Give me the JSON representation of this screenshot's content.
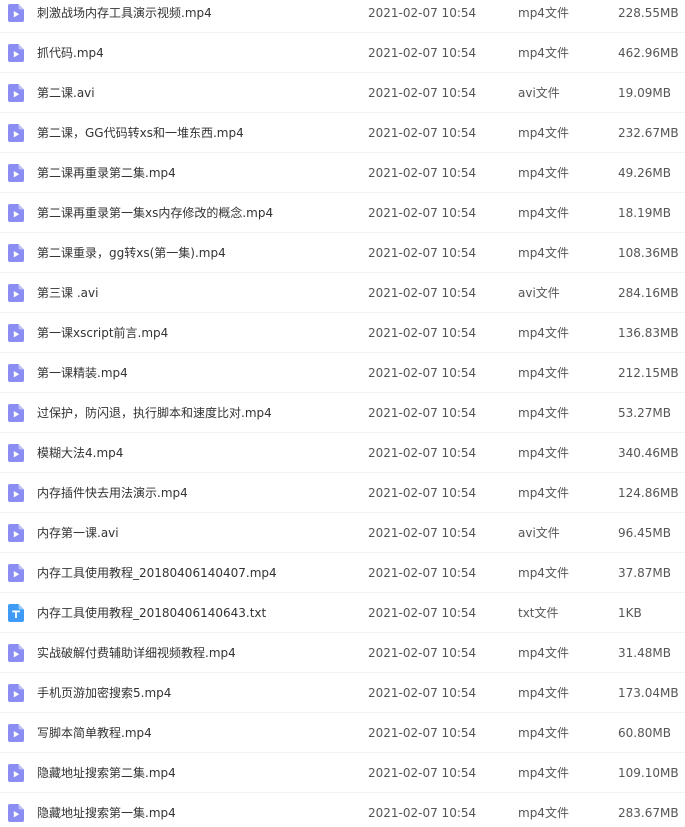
{
  "colors": {
    "video_icon": "#8c8df2",
    "text_icon": "#3f9bf5",
    "row_divider": "#f1f2f4"
  },
  "files": [
    {
      "name": "刺激战场内存工具演示视频.mp4",
      "date": "2021-02-07 10:54",
      "type": "mp4文件",
      "size": "228.55MB",
      "icon": "video-file-icon"
    },
    {
      "name": "抓代码.mp4",
      "date": "2021-02-07 10:54",
      "type": "mp4文件",
      "size": "462.96MB",
      "icon": "video-file-icon"
    },
    {
      "name": "第二课.avi",
      "date": "2021-02-07 10:54",
      "type": "avi文件",
      "size": "19.09MB",
      "icon": "video-file-icon"
    },
    {
      "name": "第二课，GG代码转xs和一堆东西.mp4",
      "date": "2021-02-07 10:54",
      "type": "mp4文件",
      "size": "232.67MB",
      "icon": "video-file-icon"
    },
    {
      "name": "第二课再重录第二集.mp4",
      "date": "2021-02-07 10:54",
      "type": "mp4文件",
      "size": "49.26MB",
      "icon": "video-file-icon"
    },
    {
      "name": "第二课再重录第一集xs内存修改的概念.mp4",
      "date": "2021-02-07 10:54",
      "type": "mp4文件",
      "size": "18.19MB",
      "icon": "video-file-icon"
    },
    {
      "name": "第二课重录，gg转xs(第一集).mp4",
      "date": "2021-02-07 10:54",
      "type": "mp4文件",
      "size": "108.36MB",
      "icon": "video-file-icon"
    },
    {
      "name": "第三课 .avi",
      "date": "2021-02-07 10:54",
      "type": "avi文件",
      "size": "284.16MB",
      "icon": "video-file-icon"
    },
    {
      "name": "第一课xscript前言.mp4",
      "date": "2021-02-07 10:54",
      "type": "mp4文件",
      "size": "136.83MB",
      "icon": "video-file-icon"
    },
    {
      "name": "第一课精装.mp4",
      "date": "2021-02-07 10:54",
      "type": "mp4文件",
      "size": "212.15MB",
      "icon": "video-file-icon"
    },
    {
      "name": "过保护，防闪退，执行脚本和速度比对.mp4",
      "date": "2021-02-07 10:54",
      "type": "mp4文件",
      "size": "53.27MB",
      "icon": "video-file-icon"
    },
    {
      "name": "模糊大法4.mp4",
      "date": "2021-02-07 10:54",
      "type": "mp4文件",
      "size": "340.46MB",
      "icon": "video-file-icon"
    },
    {
      "name": "内存插件快去用法演示.mp4",
      "date": "2021-02-07 10:54",
      "type": "mp4文件",
      "size": "124.86MB",
      "icon": "video-file-icon"
    },
    {
      "name": "内存第一课.avi",
      "date": "2021-02-07 10:54",
      "type": "avi文件",
      "size": "96.45MB",
      "icon": "video-file-icon"
    },
    {
      "name": "内存工具使用教程_20180406140407.mp4",
      "date": "2021-02-07 10:54",
      "type": "mp4文件",
      "size": "37.87MB",
      "icon": "video-file-icon"
    },
    {
      "name": "内存工具使用教程_20180406140643.txt",
      "date": "2021-02-07 10:54",
      "type": "txt文件",
      "size": "1KB",
      "icon": "text-file-icon"
    },
    {
      "name": "实战破解付费辅助详细视频教程.mp4",
      "date": "2021-02-07 10:54",
      "type": "mp4文件",
      "size": "31.48MB",
      "icon": "video-file-icon"
    },
    {
      "name": "手机页游加密搜索5.mp4",
      "date": "2021-02-07 10:54",
      "type": "mp4文件",
      "size": "173.04MB",
      "icon": "video-file-icon"
    },
    {
      "name": "写脚本简单教程.mp4",
      "date": "2021-02-07 10:54",
      "type": "mp4文件",
      "size": "60.80MB",
      "icon": "video-file-icon"
    },
    {
      "name": "隐藏地址搜索第二集.mp4",
      "date": "2021-02-07 10:54",
      "type": "mp4文件",
      "size": "109.10MB",
      "icon": "video-file-icon"
    },
    {
      "name": "隐藏地址搜索第一集.mp4",
      "date": "2021-02-07 10:54",
      "type": "mp4文件",
      "size": "283.67MB",
      "icon": "video-file-icon"
    }
  ]
}
